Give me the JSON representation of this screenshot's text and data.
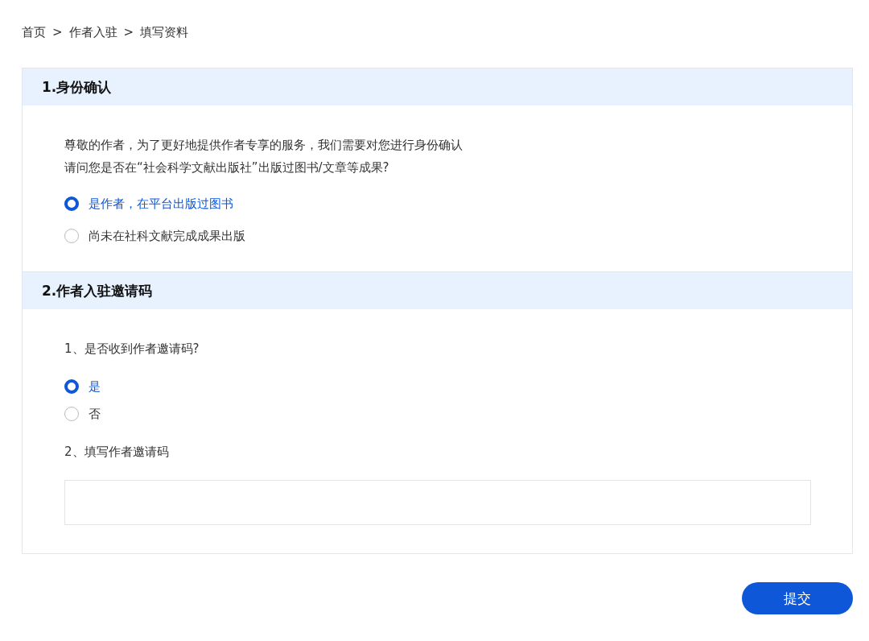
{
  "breadcrumb": {
    "separator": ">",
    "items": [
      "首页",
      "作者入驻",
      "填写资料"
    ]
  },
  "sections": [
    {
      "title": "1.身份确认",
      "blocks": [
        {
          "kind": "intro",
          "lines": [
            "尊敬的作者，为了更好地提供作者专享的服务，我们需要对您进行身份确认",
            "请问您是否在“社会科学文献出版社”出版过图书/文章等成果?"
          ]
        },
        {
          "kind": "radios",
          "options": [
            {
              "label": "是作者，在平台出版过图书",
              "selected": true
            },
            {
              "label": "尚未在社科文献完成成果出版",
              "selected": false
            }
          ]
        }
      ]
    },
    {
      "title": "2.作者入驻邀请码",
      "blocks": [
        {
          "kind": "question",
          "text": "1、是否收到作者邀请码?"
        },
        {
          "kind": "radios_tight",
          "options": [
            {
              "label": "是",
              "selected": true
            },
            {
              "label": "否",
              "selected": false
            }
          ]
        },
        {
          "kind": "question",
          "text": "2、填写作者邀请码"
        },
        {
          "kind": "input"
        }
      ]
    }
  ],
  "submit": "提交"
}
